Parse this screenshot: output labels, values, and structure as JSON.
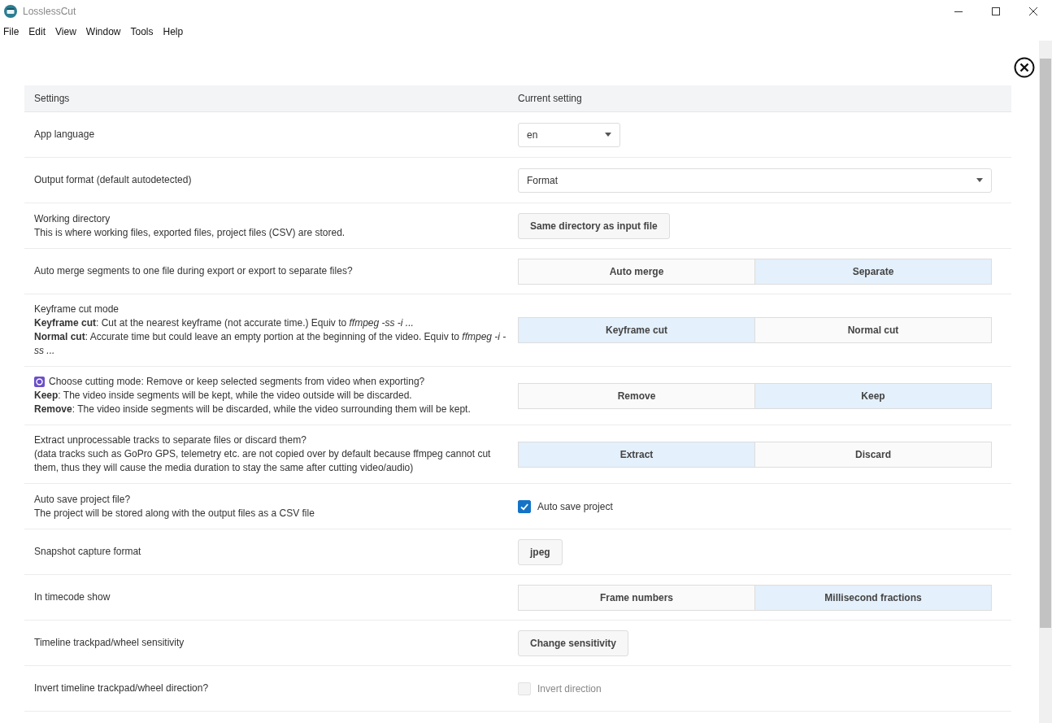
{
  "window": {
    "title": "LosslessCut"
  },
  "menu": [
    "File",
    "Edit",
    "View",
    "Window",
    "Tools",
    "Help"
  ],
  "table": {
    "columns": [
      "Settings",
      "Current setting"
    ],
    "rows": [
      {
        "kind": "select",
        "description": [
          "App language"
        ],
        "value": "en",
        "wide": false
      },
      {
        "kind": "select",
        "description": [
          "Output format (default autodetected)"
        ],
        "value": "Format",
        "wide": true
      },
      {
        "kind": "button",
        "description": [
          "Working directory",
          "This is where working files, exported files, project files (CSV) are stored."
        ],
        "label": "Same directory as input file"
      },
      {
        "kind": "segmented",
        "description": [
          "Auto merge segments to one file during export or export to separate files?"
        ],
        "options": [
          {
            "label": "Auto merge",
            "selected": false
          },
          {
            "label": "Separate",
            "selected": true
          }
        ]
      },
      {
        "kind": "segmented",
        "description": [
          "Keyframe cut mode",
          "**Keyframe cut**: Cut at the nearest keyframe (not accurate time.) Equiv to *ffmpeg -ss -i ...*",
          "**Normal cut**: Accurate time but could leave an empty portion at the beginning of the video. Equiv to *ffmpeg -i -ss ...*"
        ],
        "options": [
          {
            "label": "Keyframe cut",
            "selected": true
          },
          {
            "label": "Normal cut",
            "selected": false
          }
        ]
      },
      {
        "kind": "segmented",
        "has_icon": true,
        "description": [
          "Choose cutting mode: Remove or keep selected segments from video when exporting?",
          "**Keep**: The video inside segments will be kept, while the video outside will be discarded.",
          "**Remove**: The video inside segments will be discarded, while the video surrounding them will be kept."
        ],
        "options": [
          {
            "label": "Remove",
            "selected": false
          },
          {
            "label": "Keep",
            "selected": true
          }
        ]
      },
      {
        "kind": "segmented",
        "description": [
          "Extract unprocessable tracks to separate files or discard them?",
          "(data tracks such as GoPro GPS, telemetry etc. are not copied over by default because ffmpeg cannot cut them, thus they will cause the media duration to stay the same after cutting video/audio)"
        ],
        "options": [
          {
            "label": "Extract",
            "selected": true
          },
          {
            "label": "Discard",
            "selected": false
          }
        ]
      },
      {
        "kind": "checkbox",
        "description": [
          "Auto save project file?",
          "The project will be stored along with the output files as a CSV file"
        ],
        "label": "Auto save project",
        "checked": true,
        "disabled": false
      },
      {
        "kind": "button",
        "description": [
          "Snapshot capture format"
        ],
        "label": "jpeg"
      },
      {
        "kind": "segmented",
        "description": [
          "In timecode show"
        ],
        "options": [
          {
            "label": "Frame numbers",
            "selected": false
          },
          {
            "label": "Millisecond fractions",
            "selected": true
          }
        ]
      },
      {
        "kind": "button",
        "description": [
          "Timeline trackpad/wheel sensitivity"
        ],
        "label": "Change sensitivity"
      },
      {
        "kind": "checkbox",
        "description": [
          "Invert timeline trackpad/wheel direction?"
        ],
        "label": "Invert direction",
        "checked": false,
        "disabled": true
      }
    ]
  }
}
